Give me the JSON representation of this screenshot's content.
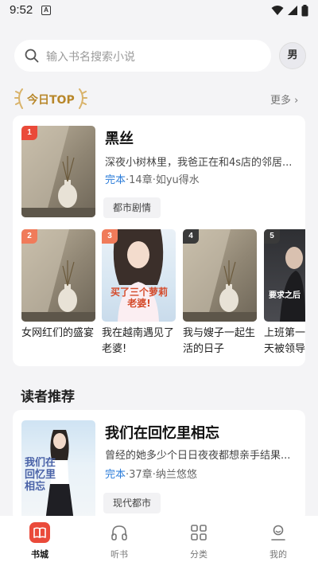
{
  "status_bar": {
    "time": "9:52",
    "notif_letter": "A"
  },
  "search": {
    "placeholder": "输入书名搜索小说"
  },
  "gender_toggle": {
    "label": "男"
  },
  "today_top": {
    "badge": "今日TOP",
    "more": "更多 ›",
    "featured": {
      "rank": "1",
      "title": "黑丝",
      "desc": "深夜小树林里，我爸正在和4s店的邻居...",
      "status": "完本",
      "meta": "·14章·如yu得水",
      "tag": "都市剧情"
    },
    "list": [
      {
        "rank": "2",
        "title": "女网红们的盛宴"
      },
      {
        "rank": "3",
        "title": "我在越南遇见了老婆!",
        "cover_text": "买了三个萝莉老婆!"
      },
      {
        "rank": "4",
        "title": "我与嫂子一起生活的日子"
      },
      {
        "rank": "5",
        "title": "上班第一天被领导和",
        "cover_text": "要求之后"
      }
    ]
  },
  "recommend": {
    "section_title": "读者推荐",
    "book": {
      "title": "我们在回忆里相忘",
      "desc": "曾经的她多少个日日夜夜都想亲手结果...",
      "status": "完本",
      "meta": "·37章·纳兰悠悠",
      "tag": "现代都市",
      "cover_text": "我们在回忆里相忘"
    }
  },
  "bottom_nav": [
    {
      "label": "书城",
      "icon": "book-store-icon",
      "active": true
    },
    {
      "label": "听书",
      "icon": "headphones-icon",
      "active": false
    },
    {
      "label": "分类",
      "icon": "category-grid-icon",
      "active": false
    },
    {
      "label": "我的",
      "icon": "profile-icon",
      "active": false
    }
  ],
  "colors": {
    "accent_red": "#ea4a3a",
    "rank_orange": "#f07b5a",
    "rank_gray": "#3a3a3a",
    "status_blue": "#2b7cd9",
    "gold": "#b8872a"
  }
}
